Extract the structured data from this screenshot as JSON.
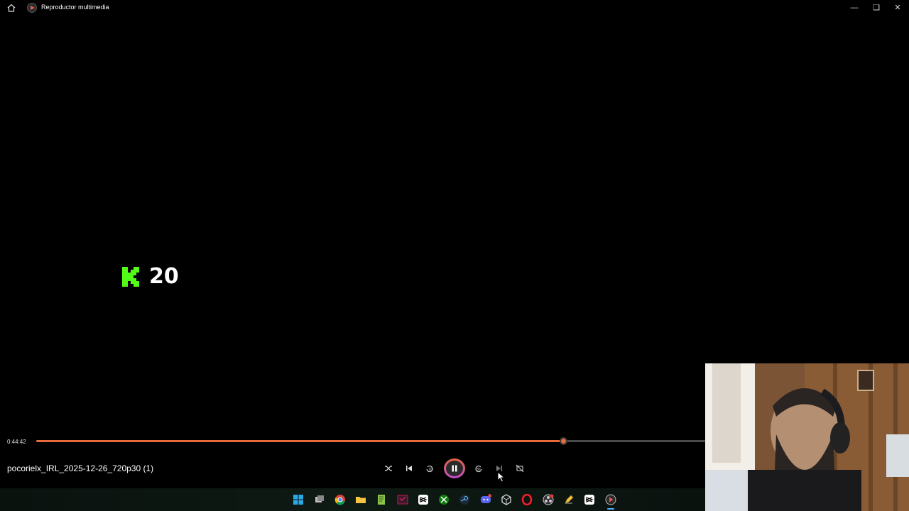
{
  "window": {
    "title": "Reproductor multimedia",
    "home_icon": "home-icon",
    "app_icon": "media-player-icon",
    "controls": [
      "minimize-icon",
      "restore-icon",
      "close-icon"
    ]
  },
  "video": {
    "overlay": {
      "logo_icon": "kick-logo-icon",
      "logo_color": "#53fc18",
      "text": "20"
    },
    "webcam": "webcam-overlay"
  },
  "player": {
    "current_time": "0:44:42",
    "progress_fraction": 0.788,
    "accent_color": "#e86a3a",
    "filename": "pocorielx_IRL_2025-12-26_720p30 (1)",
    "buttons": [
      {
        "name": "shuffle-button",
        "icon": "shuffle-icon"
      },
      {
        "name": "previous-button",
        "icon": "skip-previous-icon"
      },
      {
        "name": "rewind-10-button",
        "icon": "rewind-10-icon"
      },
      {
        "name": "pause-button",
        "icon": "pause-icon"
      },
      {
        "name": "forward-30-button",
        "icon": "forward-30-icon"
      },
      {
        "name": "next-button",
        "icon": "skip-next-icon"
      },
      {
        "name": "repeat-button",
        "icon": "repeat-off-icon"
      }
    ]
  },
  "taskbar": {
    "icons": [
      "windows-start-icon",
      "task-view-icon",
      "chrome-icon",
      "file-explorer-icon",
      "notepad-plus-icon",
      "terminal-app-icon",
      "capcut-icon",
      "xbox-icon",
      "steam-icon",
      "discord-icon",
      "unity-icon",
      "opera-gx-icon",
      "obs-icon",
      "pencil-app-icon",
      "capcut-icon",
      "media-player-icon"
    ]
  }
}
